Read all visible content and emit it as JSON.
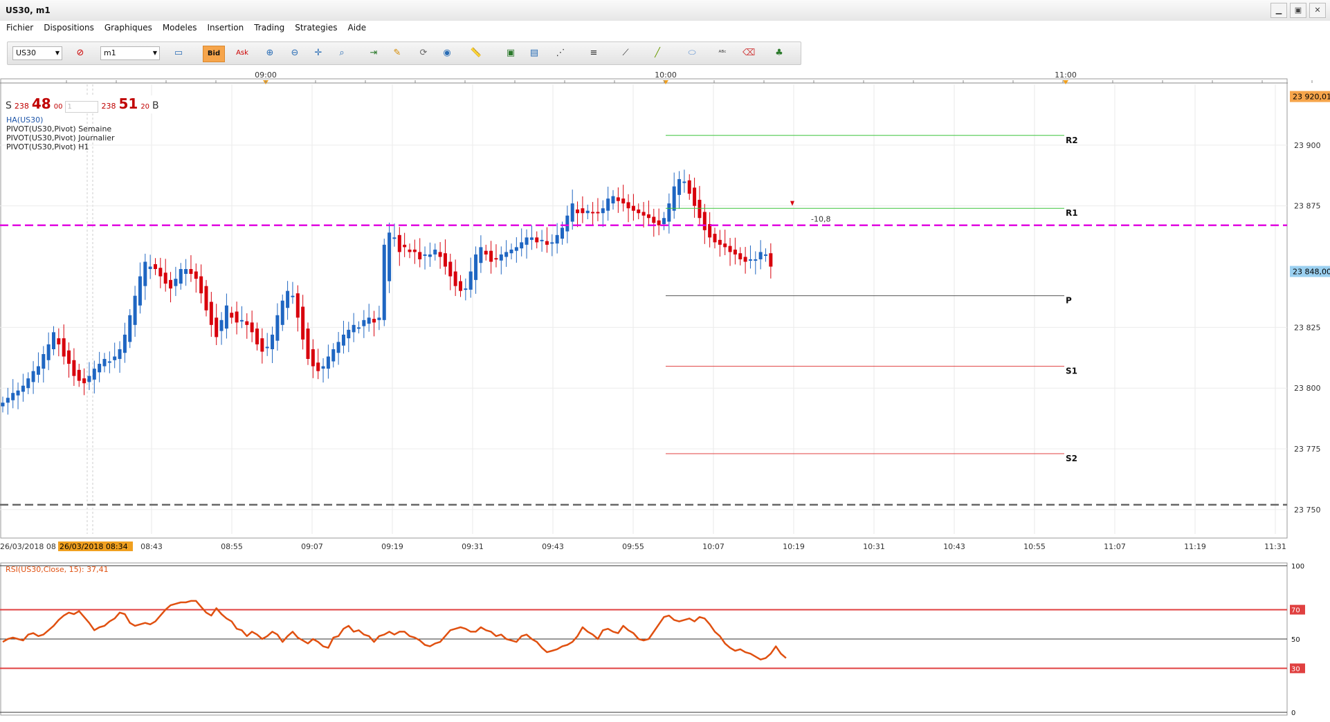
{
  "window": {
    "title": "US30, m1",
    "controls": [
      "▁",
      "▣",
      "✕"
    ]
  },
  "menu": [
    "Fichier",
    "Dispositions",
    "Graphiques",
    "Modeles",
    "Insertion",
    "Trading",
    "Strategies",
    "Aide"
  ],
  "toolbar": {
    "symbol": "US30",
    "timeframe": "m1",
    "bid_label": "Bid",
    "ask_label": "Ask"
  },
  "quote": {
    "sell_label": "S",
    "sell_prefix": "238",
    "sell_big": "48",
    "sell_sup": "00",
    "lot": "1",
    "buy_prefix": "238",
    "buy_big": "51",
    "buy_sup": "20",
    "buy_label": "B"
  },
  "indicators": [
    "HA(US30)",
    "PIVOT(US30,Pivot) Semaine",
    "PIVOT(US30,Pivot) Journalier",
    "PIVOT(US30,Pivot) H1"
  ],
  "colors": {
    "up": "#1f66c2",
    "down": "#d8000c",
    "weekly_pivot": "#e000e0",
    "r_line": "#3cc43c",
    "s_line": "#e04040",
    "rsi": "#e05010"
  },
  "chart_data": {
    "type": "candlestick",
    "ylim": [
      23740,
      23925
    ],
    "y_ticks": [
      "23 750",
      "23 775",
      "23 800",
      "23 825",
      "23 875",
      "23 900"
    ],
    "top_label": "23 920,01",
    "current_label": "23 848,00",
    "current_price": 23848,
    "x_tick_labels": [
      "08:43",
      "08:55",
      "09:07",
      "09:19",
      "09:31",
      "09:43",
      "09:55",
      "10:07",
      "10:19",
      "10:31",
      "10:43",
      "10:55",
      "11:07",
      "11:19",
      "11:31"
    ],
    "x_top_labels": [
      "09:00",
      "10:00",
      "11:00"
    ],
    "date_label": "26/03/2018 08",
    "cursor_label": "26/03/2018 08:34",
    "levels": [
      {
        "name": "R2",
        "value": 23904
      },
      {
        "name": "R1",
        "value": 23874
      },
      {
        "name": "P",
        "value": 23838
      },
      {
        "name": "S1",
        "value": 23809
      },
      {
        "name": "S2",
        "value": 23773
      }
    ],
    "weekly_pivot": 23867,
    "lower_line": 23752,
    "annotation": "-10,8",
    "closes": [
      23794,
      23796,
      23798,
      23799,
      23801,
      23804,
      23807,
      23809,
      23814,
      23818,
      23823,
      23818,
      23813,
      23810,
      23805,
      23803,
      23802,
      23805,
      23808,
      23810,
      23812,
      23811,
      23813,
      23816,
      23822,
      23830,
      23838,
      23846,
      23852,
      23850,
      23849,
      23846,
      23843,
      23841,
      23845,
      23849,
      23849,
      23847,
      23845,
      23839,
      23832,
      23826,
      23821,
      23828,
      23834,
      23829,
      23827,
      23828,
      23826,
      23823,
      23818,
      23815,
      23817,
      23822,
      23830,
      23836,
      23840,
      23838,
      23829,
      23820,
      23812,
      23809,
      23807,
      23809,
      23813,
      23816,
      23819,
      23822,
      23824,
      23826,
      23825,
      23828,
      23829,
      23827,
      23829,
      23859,
      23864,
      23862,
      23856,
      23858,
      23856,
      23856,
      23853,
      23855,
      23855,
      23857,
      23854,
      23850,
      23846,
      23842,
      23840,
      23841,
      23848,
      23855,
      23858,
      23855,
      23852,
      23853,
      23855,
      23856,
      23857,
      23858,
      23860,
      23862,
      23862,
      23860,
      23861,
      23859,
      23860,
      23863,
      23866,
      23871,
      23876,
      23872,
      23872,
      23873,
      23872,
      23872,
      23874,
      23878,
      23879,
      23877,
      23876,
      23874,
      23873,
      23872,
      23871,
      23870,
      23868,
      23867,
      23870,
      23876,
      23883,
      23886,
      23885,
      23880,
      23875,
      23870,
      23865,
      23862,
      23860,
      23859,
      23858,
      23856,
      23855,
      23853,
      23852,
      23853,
      23853,
      23856,
      23855,
      23850
    ]
  },
  "rsi": {
    "label": "RSI(US30,Close, 15): 37,41",
    "ylim": [
      0,
      100
    ],
    "ticks": [
      "100",
      "70",
      "50",
      "30",
      "0"
    ],
    "levels": [
      70,
      50,
      30
    ],
    "values": [
      48,
      50,
      51,
      50,
      49,
      53,
      54,
      52,
      53,
      56,
      59,
      63,
      66,
      68,
      67,
      69,
      65,
      61,
      56,
      58,
      59,
      62,
      64,
      68,
      67,
      61,
      59,
      60,
      61,
      60,
      62,
      66,
      70,
      73,
      74,
      75,
      75,
      76,
      76,
      72,
      68,
      66,
      71,
      67,
      64,
      62,
      57,
      56,
      52,
      55,
      53,
      50,
      52,
      55,
      53,
      48,
      52,
      55,
      51,
      49,
      47,
      50,
      48,
      45,
      44,
      51,
      52,
      57,
      59,
      55,
      56,
      53,
      52,
      48,
      52,
      53,
      55,
      53,
      55,
      55,
      52,
      51,
      49,
      46,
      45,
      47,
      48,
      52,
      56,
      57,
      58,
      57,
      55,
      55,
      58,
      56,
      55,
      52,
      53,
      50,
      49,
      48,
      52,
      53,
      50,
      48,
      44,
      41,
      42,
      43,
      45,
      46,
      48,
      52,
      58,
      55,
      53,
      50,
      56,
      57,
      55,
      54,
      59,
      56,
      54,
      50,
      49,
      50,
      55,
      60,
      65,
      66,
      63,
      62,
      63,
      64,
      62,
      65,
      64,
      60,
      55,
      52,
      47,
      44,
      42,
      43,
      41,
      40,
      38,
      36,
      37,
      40,
      45,
      40,
      37
    ]
  }
}
